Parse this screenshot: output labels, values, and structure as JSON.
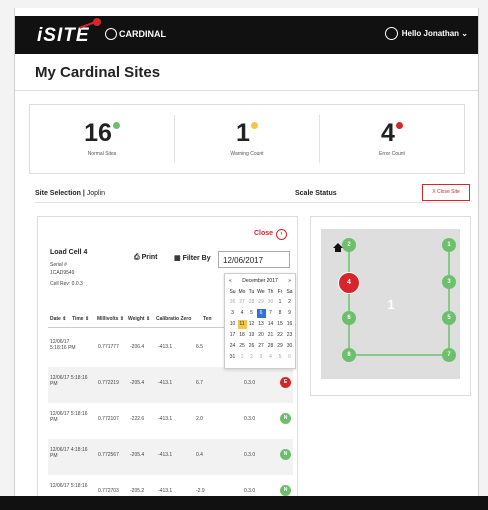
{
  "app": {
    "logo": "iSITE",
    "brand": "CARDINAL",
    "user": "Hello Jonathan"
  },
  "page": {
    "title": "My Cardinal Sites"
  },
  "stats": [
    {
      "value": "16",
      "label": "Normal Sites",
      "color": "#6cc06c"
    },
    {
      "value": "1",
      "label": "Warning Count",
      "color": "#f6c54a"
    },
    {
      "value": "4",
      "label": "Error Count",
      "color": "#d6262b"
    }
  ],
  "site": {
    "selection_label": "Site Selection",
    "selection_value": "Joplin",
    "scale_status_label": "Scale Status",
    "close_site": "X Close Site"
  },
  "loadcell": {
    "close": "Close",
    "title": "Load Cell 4",
    "serial_label": "Serial #",
    "serial_value": "1CAD9549",
    "cell_rev": "Cell Rev: 0.0.3",
    "print": "Print",
    "filter_by": "Filter By",
    "date": "12/06/2017"
  },
  "table": {
    "headers": [
      "Date",
      "Time",
      "Millivolts",
      "Weight",
      "Calibratio Zero",
      "Ten"
    ],
    "rows": [
      {
        "datetime": "12/06/17 5:18:16 PM",
        "mv": "0.771777",
        "weight": "-206.4",
        "cal": "-413.1",
        "ten": "6.5",
        "extra": "",
        "status": ""
      },
      {
        "datetime": "12/06/17 5:18:16 PM",
        "mv": "0.772219",
        "weight": "-205.4",
        "cal": "-413.1",
        "ten": "6.7",
        "extra": "0.3.0",
        "status": "E"
      },
      {
        "datetime": "12/06/17 5:18:16 PM",
        "mv": "0.772107",
        "weight": "-222.6",
        "cal": "-413.1",
        "ten": "2.0",
        "extra": "0.3.0",
        "status": "N"
      },
      {
        "datetime": "12/06/17 4:18:16 PM",
        "mv": "0.772567",
        "weight": "-205.4",
        "cal": "-413.1",
        "ten": "0.4",
        "extra": "0.3.0",
        "status": "N"
      },
      {
        "datetime": "12/06/17 5:18:16",
        "mv": "0.772703",
        "weight": "-205.2",
        "cal": "-413.1",
        "ten": "-2.9",
        "extra": "0.3.0",
        "status": "N"
      }
    ]
  },
  "calendar": {
    "title": "December 2017",
    "prev": "«",
    "next": "»",
    "dow": [
      "Su",
      "Mo",
      "Tu",
      "We",
      "Th",
      "Fr",
      "Sa"
    ],
    "weeks": [
      [
        "26",
        "27",
        "28",
        "29",
        "30",
        "1",
        "2"
      ],
      [
        "3",
        "4",
        "5",
        "6",
        "7",
        "8",
        "9"
      ],
      [
        "10",
        "11",
        "12",
        "13",
        "14",
        "15",
        "16"
      ],
      [
        "17",
        "18",
        "19",
        "20",
        "21",
        "22",
        "23"
      ],
      [
        "24",
        "25",
        "26",
        "27",
        "28",
        "29",
        "30"
      ],
      [
        "31",
        "1",
        "2",
        "3",
        "4",
        "5",
        "6"
      ]
    ]
  },
  "scale": {
    "center_label": "1",
    "nodes": [
      "2",
      "4",
      "6",
      "8",
      "1",
      "3",
      "5",
      "7"
    ]
  }
}
